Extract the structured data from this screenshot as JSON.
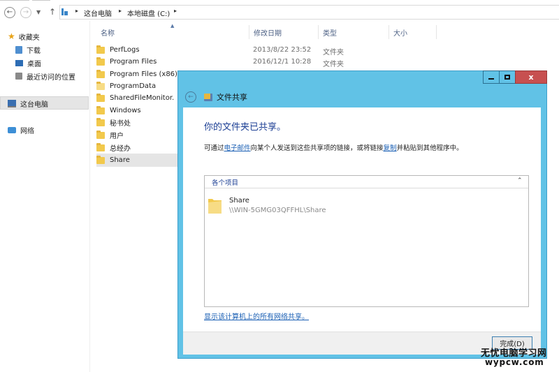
{
  "address_bar": {
    "breadcrumbs": [
      "这台电脑",
      "本地磁盘 (C:)"
    ]
  },
  "nav_pane": {
    "favorites": {
      "label": "收藏夹",
      "items": [
        "下载",
        "桌面",
        "最近访问的位置"
      ]
    },
    "this_pc": "这台电脑",
    "network": "网络"
  },
  "file_list": {
    "columns": [
      "名称",
      "修改日期",
      "类型",
      "大小"
    ],
    "rows": [
      {
        "name": "PerfLogs",
        "modified": "2013/8/22 23:52",
        "type": "文件夹"
      },
      {
        "name": "Program Files",
        "modified": "2016/12/1 10:28",
        "type": "文件夹"
      },
      {
        "name": "Program Files (x86)"
      },
      {
        "name": "ProgramData"
      },
      {
        "name": "SharedFileMonitor."
      },
      {
        "name": "Windows"
      },
      {
        "name": "秘书处"
      },
      {
        "name": "用户"
      },
      {
        "name": "总经办"
      },
      {
        "name": "Share"
      }
    ],
    "selected": "Share"
  },
  "dialog": {
    "title": "文件共享",
    "heading": "你的文件夹已共享。",
    "message": {
      "part1": "可通过",
      "link1": "电子邮件",
      "part2": "向某个人发送到这些共享项的链接，或将链接",
      "link2": "复制",
      "part3": "并粘贴到其他程序中。"
    },
    "items_header": "各个项目",
    "item": {
      "name": "Share",
      "path": "\\\\WIN-5GMG03QFFHL\\Share"
    },
    "show_all_link": "显示该计算机上的所有网络共享。",
    "done_button": "完成(D)",
    "close_glyph": "x"
  },
  "watermark": {
    "line1": "无忧电脑学习网",
    "line2": "wypcw.com"
  },
  "colors": {
    "dialog_frame": "#61c2e6",
    "close_button": "#c75050",
    "heading": "#1c3f94",
    "link": "#1a5fb4",
    "folder": "#f2c94c"
  }
}
